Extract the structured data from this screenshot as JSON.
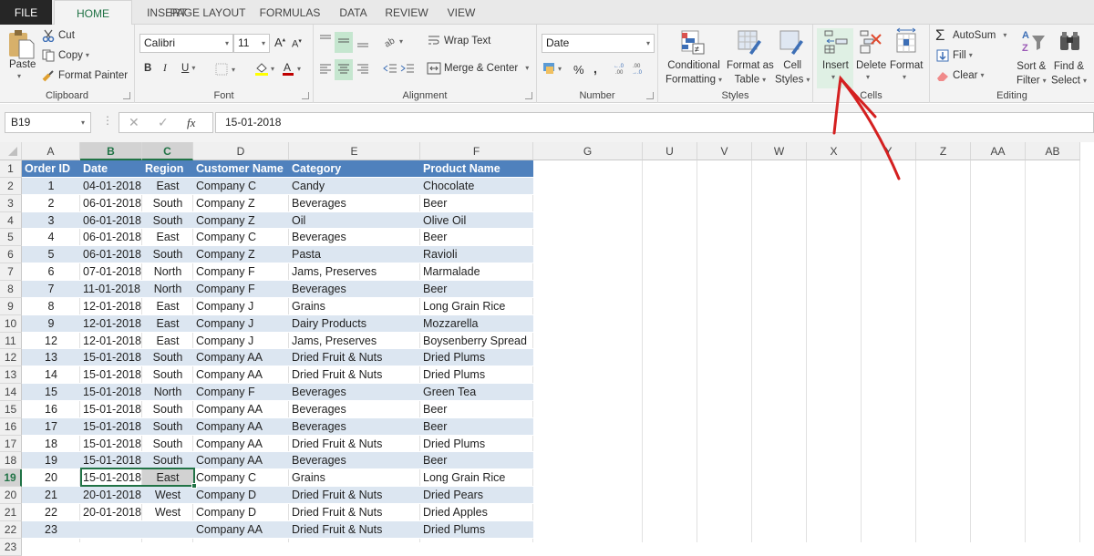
{
  "tabs": [
    "FILE",
    "HOME",
    "INSERT",
    "PAGE LAYOUT",
    "FORMULAS",
    "DATA",
    "REVIEW",
    "VIEW"
  ],
  "active_tab": "HOME",
  "ribbon": {
    "clipboard": {
      "label": "Clipboard",
      "paste": "Paste",
      "cut": "Cut",
      "copy": "Copy",
      "format_painter": "Format Painter"
    },
    "font": {
      "label": "Font",
      "font_name": "Calibri",
      "font_size": "11",
      "bold": "B",
      "italic": "I",
      "underline": "U",
      "grow": "A",
      "shrink": "A",
      "font_color": "A"
    },
    "alignment": {
      "label": "Alignment",
      "wrap_text": "Wrap Text",
      "merge_center": "Merge & Center"
    },
    "number": {
      "label": "Number",
      "format": "Date",
      "percent": "%",
      "comma": ","
    },
    "styles": {
      "label": "Styles",
      "conditional_1": "Conditional",
      "conditional_2": "Formatting",
      "format_table_1": "Format as",
      "format_table_2": "Table",
      "cell_styles_1": "Cell",
      "cell_styles_2": "Styles"
    },
    "cells": {
      "label": "Cells",
      "insert": "Insert",
      "delete": "Delete",
      "format": "Format"
    },
    "editing": {
      "label": "Editing",
      "autosum": "AutoSum",
      "fill": "Fill",
      "clear": "Clear",
      "sort_1": "Sort &",
      "sort_2": "Filter",
      "find_1": "Find &",
      "find_2": "Select"
    }
  },
  "formula_bar": {
    "name_box": "B19",
    "fx": "fx",
    "value": "15-01-2018"
  },
  "columns": [
    "A",
    "B",
    "C",
    "D",
    "E",
    "F",
    "G",
    "U",
    "V",
    "W",
    "X",
    "Y",
    "Z",
    "AA",
    "AB"
  ],
  "selected_columns": [
    "B",
    "C"
  ],
  "selected_row": "19",
  "table": {
    "headers": [
      "Order ID",
      "Date",
      "Region",
      "Customer Name",
      "Category",
      "Product Name"
    ],
    "rows": [
      [
        "1",
        "04-01-2018",
        "East",
        "Company C",
        "Candy",
        "Chocolate"
      ],
      [
        "2",
        "06-01-2018",
        "South",
        "Company Z",
        "Beverages",
        "Beer"
      ],
      [
        "3",
        "06-01-2018",
        "South",
        "Company Z",
        "Oil",
        "Olive Oil"
      ],
      [
        "4",
        "06-01-2018",
        "East",
        "Company C",
        "Beverages",
        "Beer"
      ],
      [
        "5",
        "06-01-2018",
        "South",
        "Company Z",
        "Pasta",
        "Ravioli"
      ],
      [
        "6",
        "07-01-2018",
        "North",
        "Company F",
        "Jams, Preserves",
        "Marmalade"
      ],
      [
        "7",
        "11-01-2018",
        "North",
        "Company F",
        "Beverages",
        "Beer"
      ],
      [
        "8",
        "12-01-2018",
        "East",
        "Company J",
        "Grains",
        "Long Grain Rice"
      ],
      [
        "9",
        "12-01-2018",
        "East",
        "Company J",
        "Dairy Products",
        "Mozzarella"
      ],
      [
        "12",
        "12-01-2018",
        "East",
        "Company J",
        "Jams, Preserves",
        "Boysenberry Spread"
      ],
      [
        "13",
        "15-01-2018",
        "South",
        "Company AA",
        "Dried Fruit & Nuts",
        "Dried Plums"
      ],
      [
        "14",
        "15-01-2018",
        "South",
        "Company AA",
        "Dried Fruit & Nuts",
        "Dried Plums"
      ],
      [
        "15",
        "15-01-2018",
        "North",
        "Company F",
        "Beverages",
        "Green Tea"
      ],
      [
        "16",
        "15-01-2018",
        "South",
        "Company AA",
        "Beverages",
        "Beer"
      ],
      [
        "17",
        "15-01-2018",
        "South",
        "Company AA",
        "Beverages",
        "Beer"
      ],
      [
        "18",
        "15-01-2018",
        "South",
        "Company AA",
        "Dried Fruit & Nuts",
        "Dried Plums"
      ],
      [
        "19",
        "15-01-2018",
        "South",
        "Company AA",
        "Beverages",
        "Beer"
      ],
      [
        "20",
        "15-01-2018",
        "East",
        "Company C",
        "Grains",
        "Long Grain Rice"
      ],
      [
        "21",
        "20-01-2018",
        "West",
        "Company D",
        "Dried Fruit & Nuts",
        "Dried Pears"
      ],
      [
        "22",
        "20-01-2018",
        "West",
        "Company D",
        "Dried Fruit & Nuts",
        "Dried Apples"
      ],
      [
        "23",
        "",
        "",
        "Company AA",
        "Dried Fruit & Nuts",
        "Dried Plums"
      ]
    ]
  },
  "colors": {
    "accent": "#217346",
    "table_header": "#4f81bd",
    "band": "#dce6f1",
    "annotation": "#d42020"
  }
}
